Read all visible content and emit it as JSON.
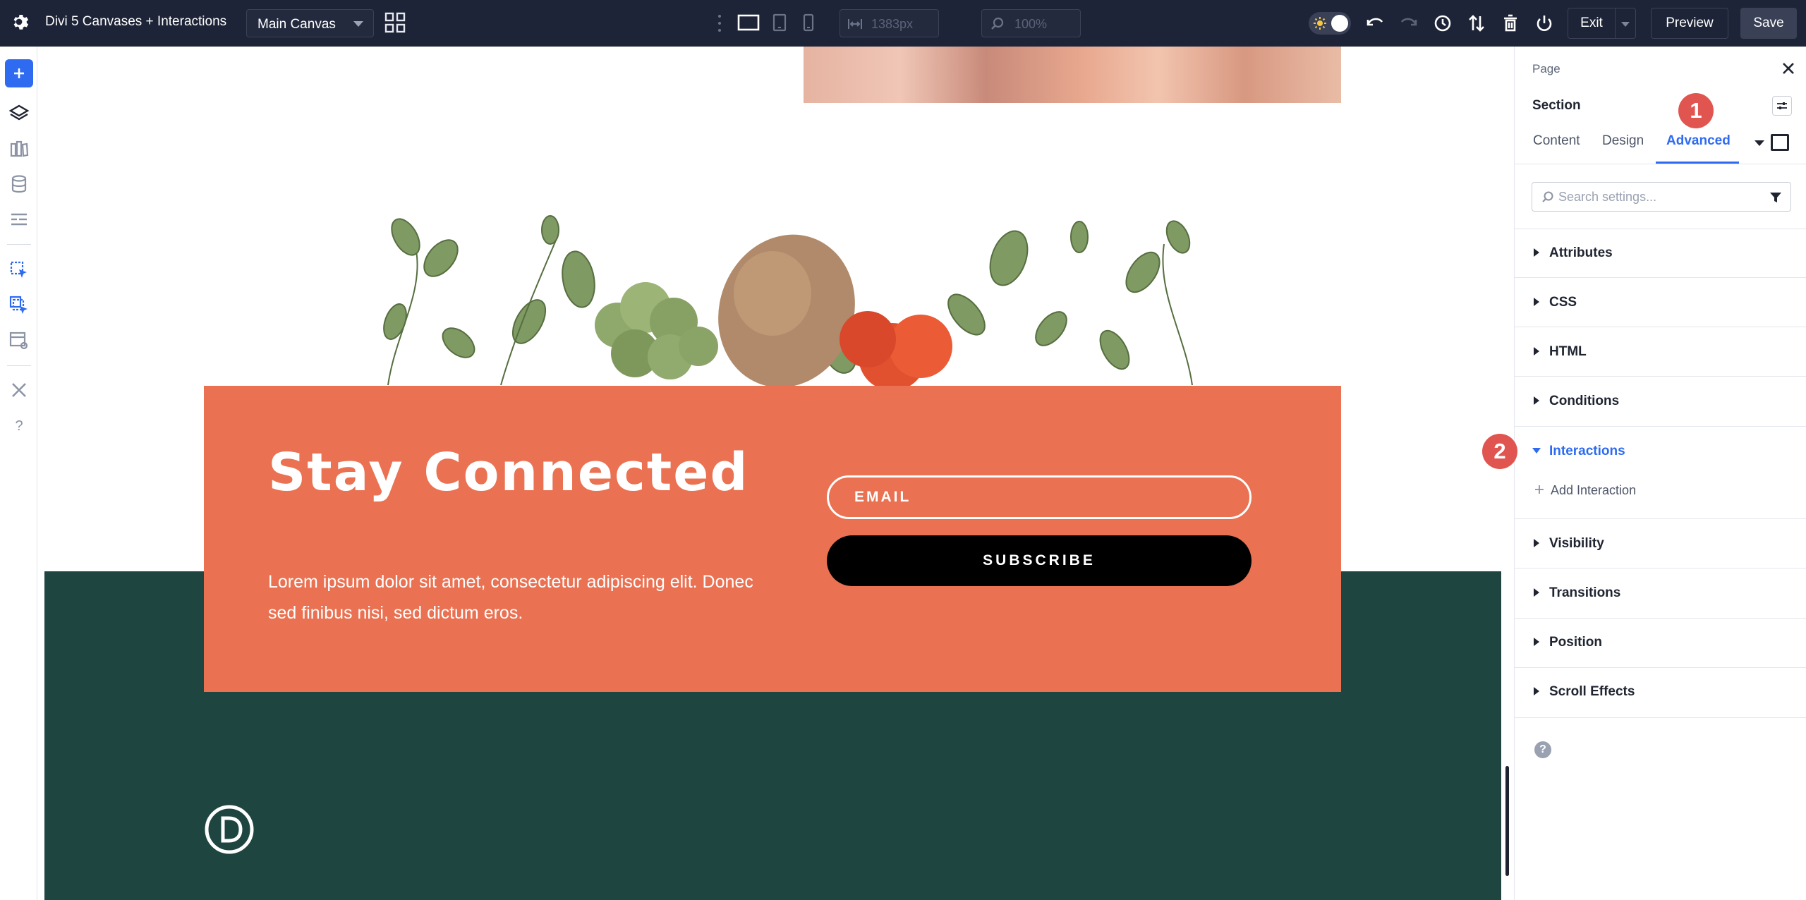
{
  "topbar": {
    "title": "Divi 5 Canvases + Interactions",
    "canvas_select": "Main Canvas",
    "width_value": "1383px",
    "zoom_value": "100%",
    "exit_label": "Exit",
    "preview_label": "Preview",
    "save_label": "Save"
  },
  "canvas": {
    "heading": "Stay Connected",
    "body": "Lorem ipsum dolor sit amet, consectetur adipiscing elit. Donec sed finibus nisi, sed dictum eros.",
    "email_placeholder": "EMAIL",
    "subscribe_label": "SUBSCRIBE"
  },
  "panel": {
    "breadcrumb": "Page",
    "title": "Section",
    "tabs": [
      {
        "label": "Content",
        "active": false
      },
      {
        "label": "Design",
        "active": false
      },
      {
        "label": "Advanced",
        "active": true
      }
    ],
    "search_placeholder": "Search settings...",
    "sections": [
      {
        "label": "Attributes",
        "open": false
      },
      {
        "label": "CSS",
        "open": false
      },
      {
        "label": "HTML",
        "open": false
      },
      {
        "label": "Conditions",
        "open": false
      },
      {
        "label": "Interactions",
        "open": true
      },
      {
        "label": "Visibility",
        "open": false
      },
      {
        "label": "Transitions",
        "open": false
      },
      {
        "label": "Position",
        "open": false
      },
      {
        "label": "Scroll Effects",
        "open": false
      }
    ],
    "add_interaction_label": "Add Interaction",
    "help_glyph": "?"
  },
  "badges": [
    "1",
    "2"
  ],
  "colors": {
    "topbar_bg": "#1e2437",
    "accent_blue": "#2e6bf1",
    "card_orange": "#ea7151",
    "footer_green": "#1f4541",
    "badge_red": "#e0554f"
  }
}
